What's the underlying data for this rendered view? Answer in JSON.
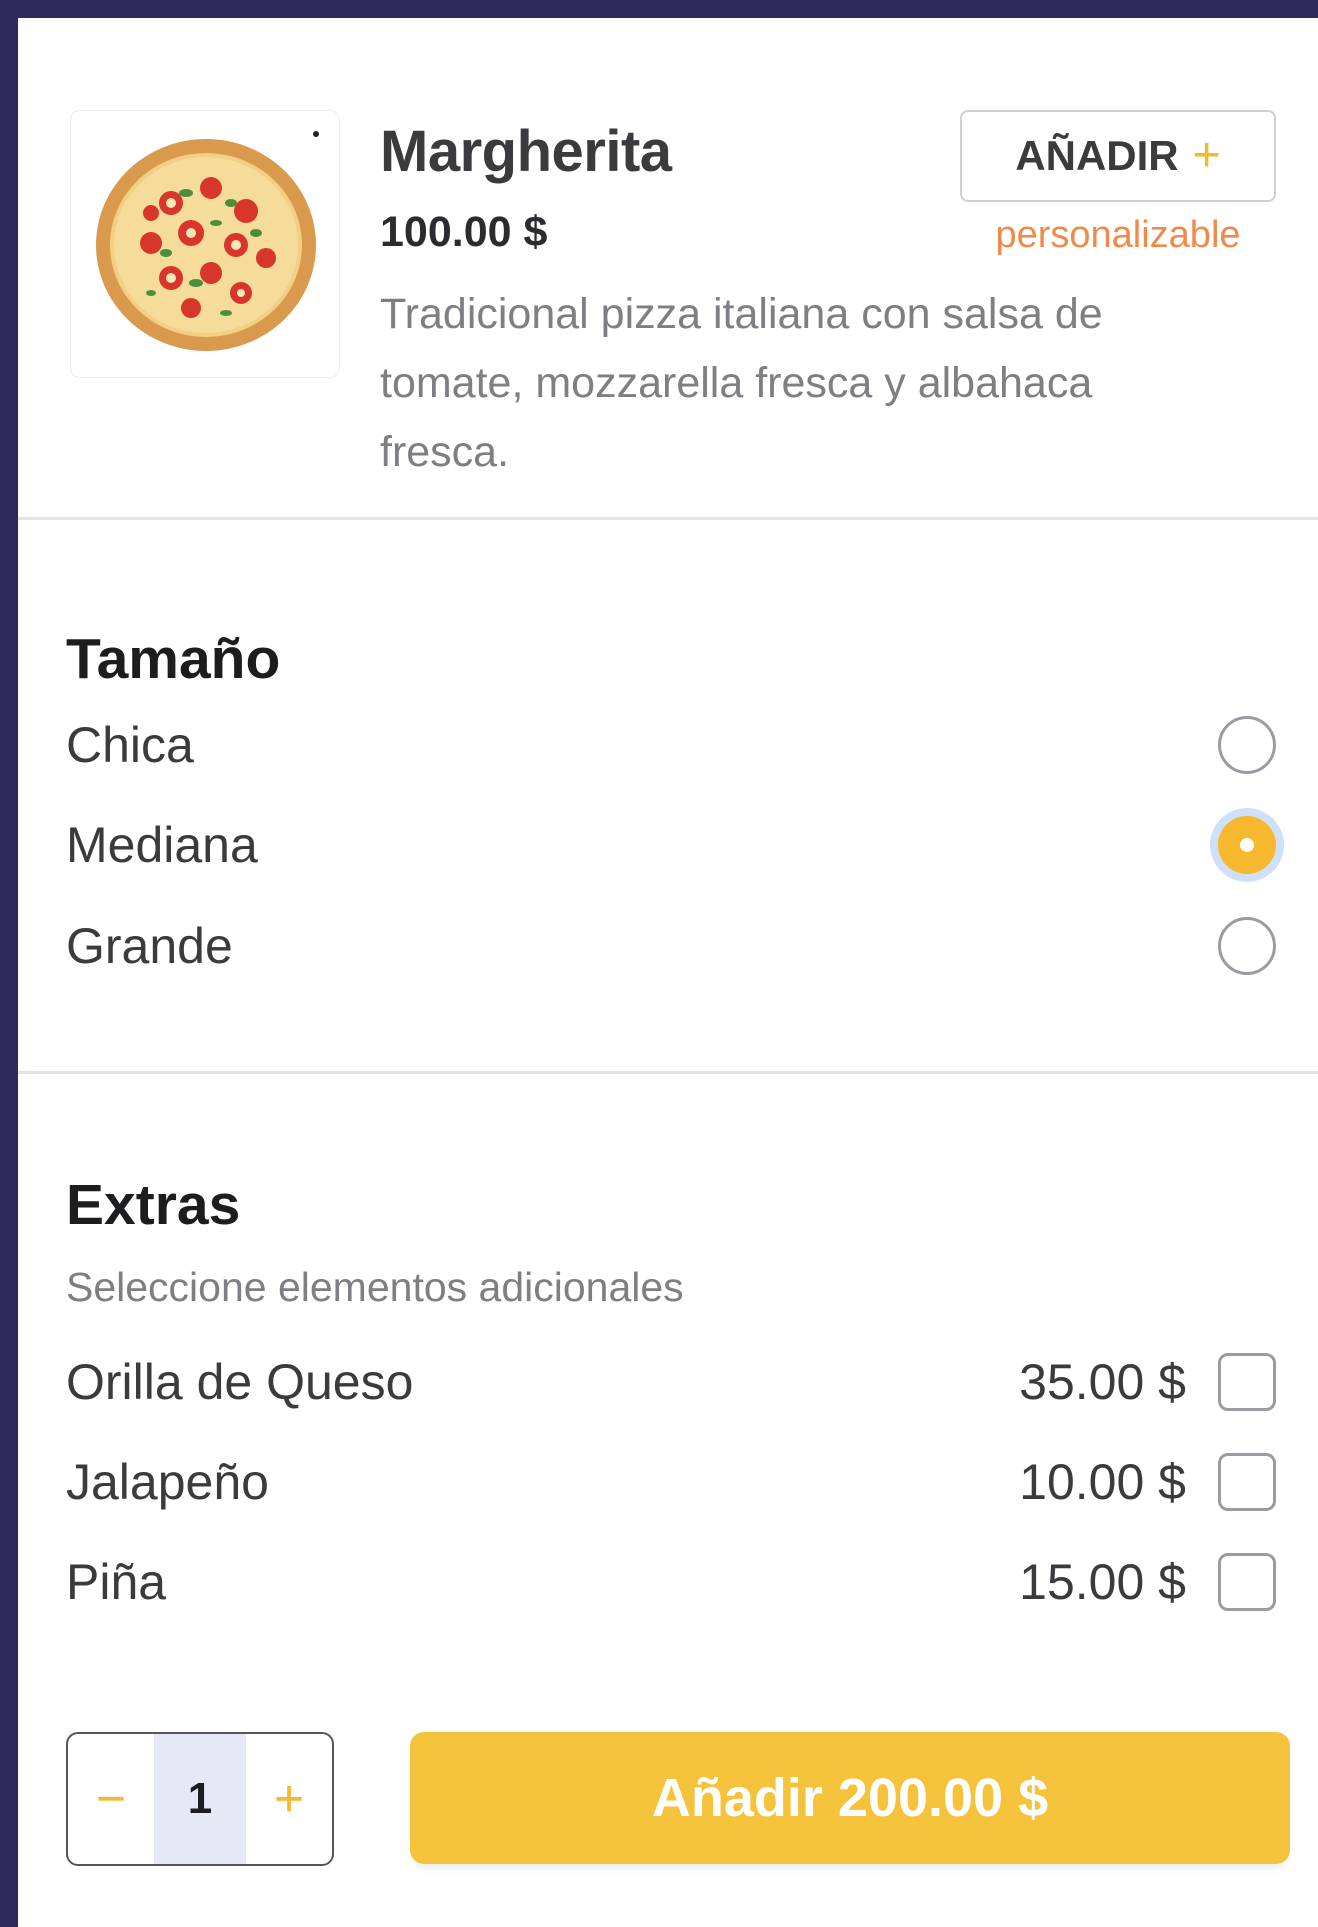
{
  "product": {
    "name": "Margherita",
    "price": "100.00 $",
    "description": "Tradicional pizza italiana con salsa de tomate, mozzarella fresca y albahaca fresca.",
    "add_label": "AÑADIR",
    "add_icon": "plus-icon",
    "customizable_note": "personalizable",
    "image_icon": "pizza-image"
  },
  "size": {
    "title": "Tamaño",
    "options": [
      {
        "label": "Chica",
        "selected": false
      },
      {
        "label": "Mediana",
        "selected": true
      },
      {
        "label": "Grande",
        "selected": false
      }
    ]
  },
  "extras": {
    "title": "Extras",
    "subtitle": "Seleccione elementos adicionales",
    "items": [
      {
        "label": "Orilla de Queso",
        "price": "35.00 $",
        "checked": false
      },
      {
        "label": "Jalapeño",
        "price": "10.00 $",
        "checked": false
      },
      {
        "label": "Piña",
        "price": "15.00 $",
        "checked": false
      }
    ]
  },
  "footer": {
    "quantity": "1",
    "decrement_symbol": "−",
    "increment_symbol": "+",
    "submit_label": "Añadir 200.00 $"
  },
  "colors": {
    "accent": "#f5b82e",
    "note": "#f08a4b",
    "frame": "#2f2a5e"
  }
}
